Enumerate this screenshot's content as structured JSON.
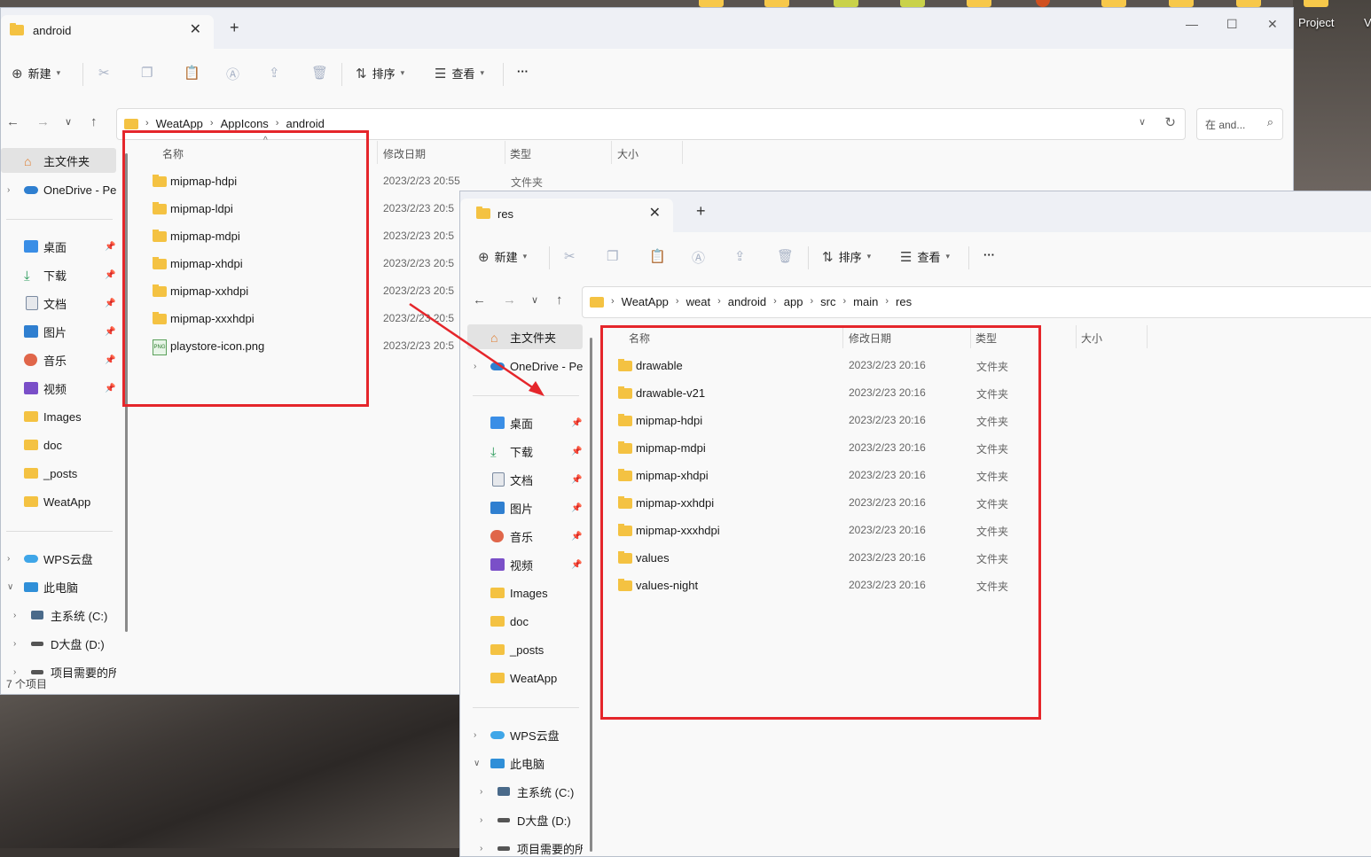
{
  "desktop": {
    "labels": [
      "Project",
      "V"
    ]
  },
  "window1": {
    "tab_title": "android",
    "toolbar": {
      "new_label": "新建",
      "sort_label": "排序",
      "view_label": "查看",
      "more_label": "···"
    },
    "breadcrumb": [
      "WeatApp",
      "AppIcons",
      "android"
    ],
    "search_placeholder": "在 and...",
    "sidebar": {
      "home": "主文件夹",
      "onedrive": "OneDrive - Per",
      "quick": [
        {
          "label": "桌面",
          "icon": "desktop-icon",
          "color": "#3a8ee6"
        },
        {
          "label": "下载",
          "icon": "download-icon",
          "color": "#2a9a5a"
        },
        {
          "label": "文档",
          "icon": "document-icon",
          "color": "#7a8aa0"
        },
        {
          "label": "图片",
          "icon": "pictures-icon",
          "color": "#2f7fd0"
        },
        {
          "label": "音乐",
          "icon": "music-icon",
          "color": "#e0664a"
        },
        {
          "label": "视频",
          "icon": "video-icon",
          "color": "#7a4fc8"
        }
      ],
      "folders": [
        "Images",
        "doc",
        "_posts",
        "WeatApp"
      ],
      "wps": "WPS云盘",
      "pc": "此电脑",
      "drives": [
        "主系统 (C:)",
        "D大盘 (D:)",
        "项目需要的所有"
      ]
    },
    "columns": {
      "name": "名称",
      "date": "修改日期",
      "type": "类型",
      "size": "大小"
    },
    "files": [
      {
        "name": "mipmap-hdpi",
        "date": "2023/2/23 20:55",
        "type": "文件夹",
        "kind": "folder"
      },
      {
        "name": "mipmap-ldpi",
        "date": "2023/2/23 20:5",
        "type": "",
        "kind": "folder"
      },
      {
        "name": "mipmap-mdpi",
        "date": "2023/2/23 20:5",
        "type": "",
        "kind": "folder"
      },
      {
        "name": "mipmap-xhdpi",
        "date": "2023/2/23 20:5",
        "type": "",
        "kind": "folder"
      },
      {
        "name": "mipmap-xxhdpi",
        "date": "2023/2/23 20:5",
        "type": "",
        "kind": "folder"
      },
      {
        "name": "mipmap-xxxhdpi",
        "date": "2023/2/23 20:5",
        "type": "",
        "kind": "folder"
      },
      {
        "name": "playstore-icon.png",
        "date": "2023/2/23 20:5",
        "type": "",
        "kind": "png"
      }
    ],
    "status": "7 个项目"
  },
  "window2": {
    "tab_title": "res",
    "toolbar": {
      "new_label": "新建",
      "sort_label": "排序",
      "view_label": "查看",
      "more_label": "···"
    },
    "breadcrumb": [
      "WeatApp",
      "weat",
      "android",
      "app",
      "src",
      "main",
      "res"
    ],
    "sidebar": {
      "home": "主文件夹",
      "onedrive": "OneDrive - Per",
      "quick": [
        {
          "label": "桌面",
          "icon": "desktop-icon",
          "color": "#3a8ee6"
        },
        {
          "label": "下载",
          "icon": "download-icon",
          "color": "#2a9a5a"
        },
        {
          "label": "文档",
          "icon": "document-icon",
          "color": "#7a8aa0"
        },
        {
          "label": "图片",
          "icon": "pictures-icon",
          "color": "#2f7fd0"
        },
        {
          "label": "音乐",
          "icon": "music-icon",
          "color": "#e0664a"
        },
        {
          "label": "视频",
          "icon": "video-icon",
          "color": "#7a4fc8"
        }
      ],
      "folders": [
        "Images",
        "doc",
        "_posts",
        "WeatApp"
      ],
      "wps": "WPS云盘",
      "pc": "此电脑",
      "drives": [
        "主系统 (C:)",
        "D大盘 (D:)",
        "项目需要的所有"
      ]
    },
    "columns": {
      "name": "名称",
      "date": "修改日期",
      "type": "类型",
      "size": "大小"
    },
    "files": [
      {
        "name": "drawable",
        "date": "2023/2/23 20:16",
        "type": "文件夹"
      },
      {
        "name": "drawable-v21",
        "date": "2023/2/23 20:16",
        "type": "文件夹"
      },
      {
        "name": "mipmap-hdpi",
        "date": "2023/2/23 20:16",
        "type": "文件夹"
      },
      {
        "name": "mipmap-mdpi",
        "date": "2023/2/23 20:16",
        "type": "文件夹"
      },
      {
        "name": "mipmap-xhdpi",
        "date": "2023/2/23 20:16",
        "type": "文件夹"
      },
      {
        "name": "mipmap-xxhdpi",
        "date": "2023/2/23 20:16",
        "type": "文件夹"
      },
      {
        "name": "mipmap-xxxhdpi",
        "date": "2023/2/23 20:16",
        "type": "文件夹"
      },
      {
        "name": "values",
        "date": "2023/2/23 20:16",
        "type": "文件夹"
      },
      {
        "name": "values-night",
        "date": "2023/2/23 20:16",
        "type": "文件夹"
      }
    ]
  },
  "colors": {
    "highlight_red": "#e5262b",
    "folder_yellow": "#f4c242",
    "accent_blue": "#2f7fd0"
  }
}
